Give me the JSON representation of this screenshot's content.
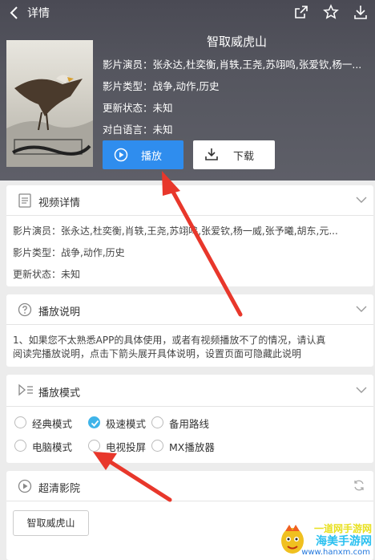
{
  "topbar": {
    "title": "详情"
  },
  "movie": {
    "title": "智取威虎山",
    "info": [
      "影片演员：张永达,杜奕衡,肖轶,王尧,苏翊鸣,张爱钦,杨一...",
      "影片类型：战争,动作,历史",
      "更新状态：未知",
      "对白语言：未知"
    ],
    "play_label": "播放",
    "download_label": "下载"
  },
  "details": {
    "title": "视频详情",
    "lines": [
      "影片演员：张永达,杜奕衡,肖轶,王尧,苏翊鸣,张爱钦,杨一威,张予曦,胡东,元...",
      "影片类型：战争,动作,历史",
      "更新状态：未知"
    ]
  },
  "instructions": {
    "title": "播放说明",
    "line1": "1、如果您不太熟悉APP的具体使用，或者有视频播放不了的情况，请认真",
    "line2": "阅读完播放说明，点击下箭头展开具体说明，设置页面可隐藏此说明"
  },
  "play_mode": {
    "title": "播放模式",
    "options": [
      {
        "label": "经典模式",
        "selected": false
      },
      {
        "label": "极速模式",
        "selected": true
      },
      {
        "label": "备用路线",
        "selected": false
      },
      {
        "label": "电脑模式",
        "selected": false
      },
      {
        "label": "电视投屏",
        "selected": false
      },
      {
        "label": "MX播放器",
        "selected": false
      }
    ]
  },
  "source": {
    "title": "超清影院",
    "episode_label": "智取威虎山"
  },
  "watermark": {
    "line1": "一道网手游网",
    "line2": "海美手游网",
    "line3": "www.hanxm.com"
  },
  "colors": {
    "accent": "#2f8dee",
    "radio_on": "#3fb4e9",
    "arrow": "#e8372b"
  }
}
